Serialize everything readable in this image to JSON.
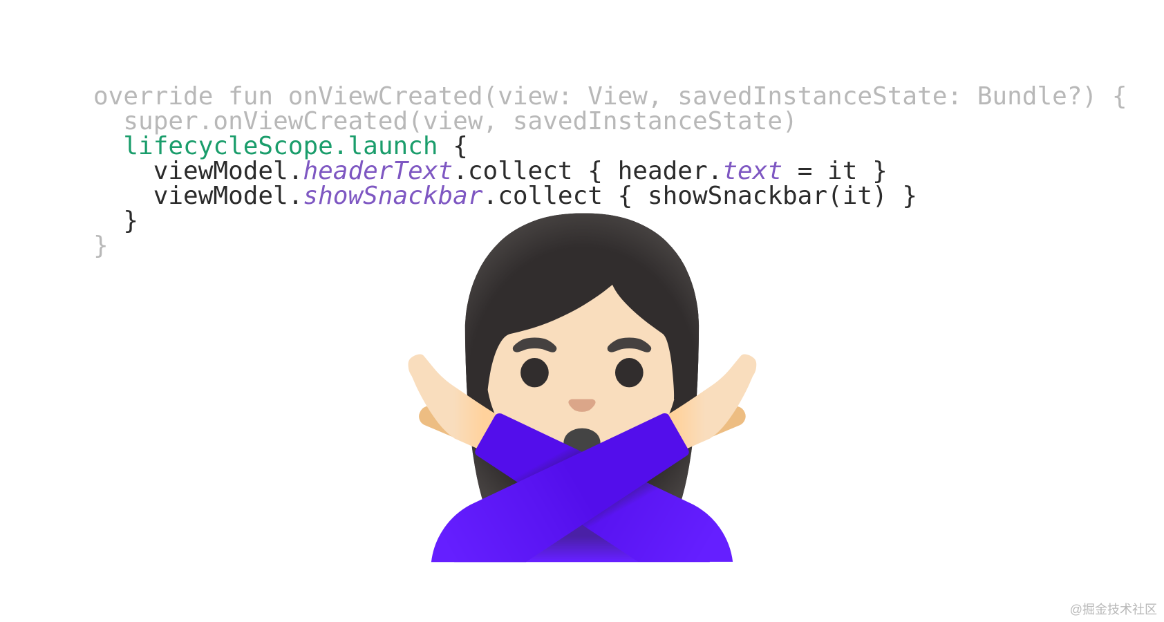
{
  "code": {
    "line1": {
      "a": "override fun onViewCreated(view: View, savedInstanceState: Bundle?) {"
    },
    "line2": {
      "a": "  super.onViewCreated(view, savedInstanceState)"
    },
    "line3": {
      "a": "  ",
      "b": "lifecycleScope",
      "c": ".",
      "d": "launch ",
      "e": "{"
    },
    "line4": {
      "a": "    viewModel.",
      "b": "headerText",
      "c": ".collect { header.",
      "d": "text",
      "e": " = it }"
    },
    "line5": {
      "a": "    viewModel.",
      "b": "showSnackbar",
      "c": ".collect { showSnackbar(it) }"
    },
    "line6": {
      "a": "  }"
    },
    "line7": {
      "a": "}"
    }
  },
  "emoji": "🙅🏻‍♀️",
  "watermark": "@掘金技术社区"
}
